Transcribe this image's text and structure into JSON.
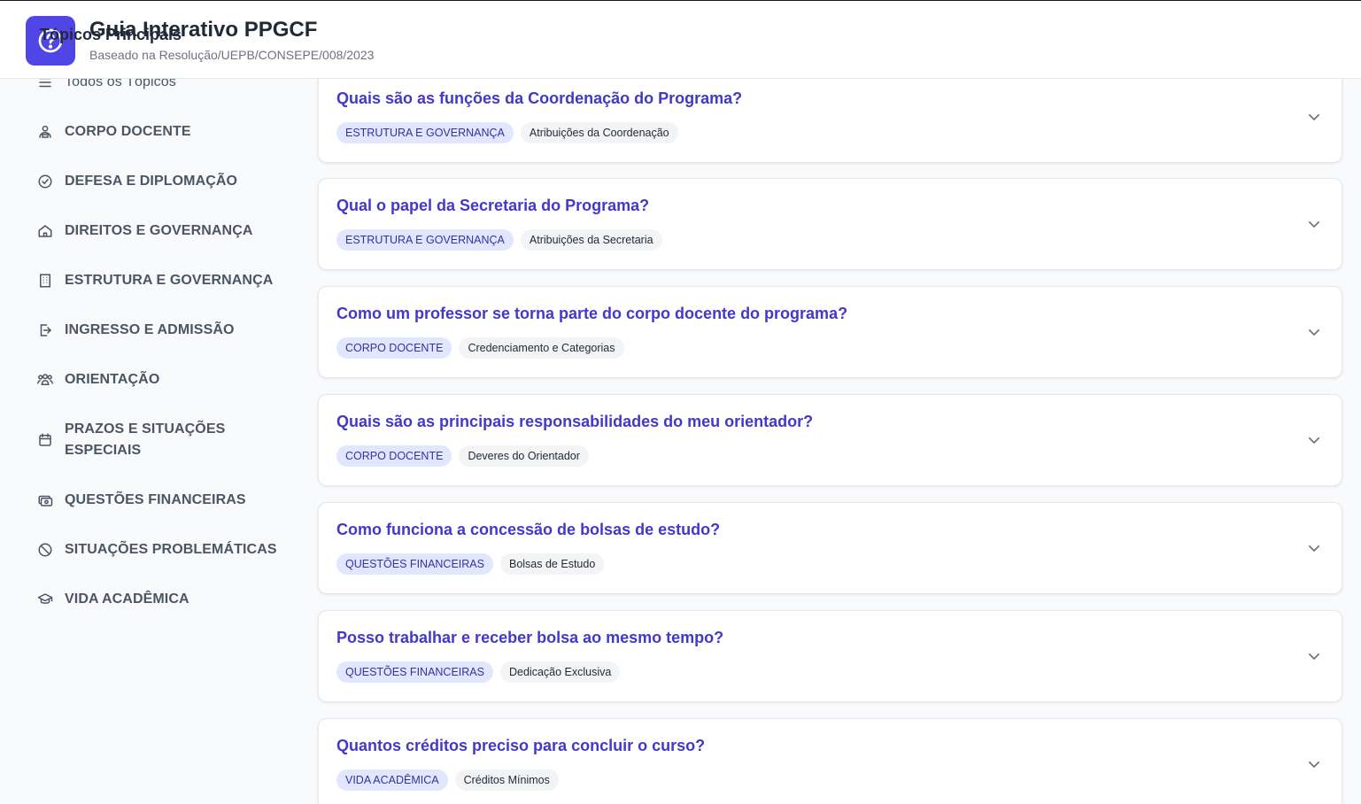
{
  "header": {
    "title": "Guia Interativo PPGCF",
    "subtitle": "Baseado na Resolução/UEPB/CONSEPE/008/2023"
  },
  "sidebar": {
    "heading": "Tópicos Principais",
    "items": [
      {
        "label": "Todos os Tópicos",
        "icon": "menu-icon"
      },
      {
        "label": "CORPO DOCENTE",
        "icon": "user-podium-icon"
      },
      {
        "label": "DEFESA E DIPLOMAÇÃO",
        "icon": "check-circle-icon"
      },
      {
        "label": "DIREITOS E GOVERNANÇA",
        "icon": "home-icon"
      },
      {
        "label": "ESTRUTURA E GOVERNANÇA",
        "icon": "building-icon"
      },
      {
        "label": "INGRESSO E ADMISSÃO",
        "icon": "login-icon"
      },
      {
        "label": "ORIENTAÇÃO",
        "icon": "users-icon"
      },
      {
        "label": "PRAZOS E SITUAÇÕES ESPECIAIS",
        "icon": "calendar-icon"
      },
      {
        "label": "QUESTÕES FINANCEIRAS",
        "icon": "money-icon"
      },
      {
        "label": "SITUAÇÕES PROBLEMÁTICAS",
        "icon": "ban-icon"
      },
      {
        "label": "VIDA ACADÊMICA",
        "icon": "graduation-cap-icon"
      }
    ]
  },
  "faqs": [
    {
      "question": "Quais são as funções da Coordenação do Programa?",
      "category": "ESTRUTURA E GOVERNANÇA",
      "subtopic": "Atribuições da Coordenação"
    },
    {
      "question": "Qual o papel da Secretaria do Programa?",
      "category": "ESTRUTURA E GOVERNANÇA",
      "subtopic": "Atribuições da Secretaria"
    },
    {
      "question": "Como um professor se torna parte do corpo docente do programa?",
      "category": "CORPO DOCENTE",
      "subtopic": "Credenciamento e Categorias"
    },
    {
      "question": "Quais são as principais responsabilidades do meu orientador?",
      "category": "CORPO DOCENTE",
      "subtopic": "Deveres do Orientador"
    },
    {
      "question": "Como funciona a concessão de bolsas de estudo?",
      "category": "QUESTÕES FINANCEIRAS",
      "subtopic": "Bolsas de Estudo"
    },
    {
      "question": "Posso trabalhar e receber bolsa ao mesmo tempo?",
      "category": "QUESTÕES FINANCEIRAS",
      "subtopic": "Dedicação Exclusiva"
    },
    {
      "question": "Quantos créditos preciso para concluir o curso?",
      "category": "VIDA ACADÊMICA",
      "subtopic": "Créditos Mínimos"
    }
  ],
  "colors": {
    "accent": "#4f46e5",
    "question": "#4338ca",
    "category_tag_bg": "#e0e7ff",
    "subtopic_tag_bg": "#f3f4f6"
  }
}
